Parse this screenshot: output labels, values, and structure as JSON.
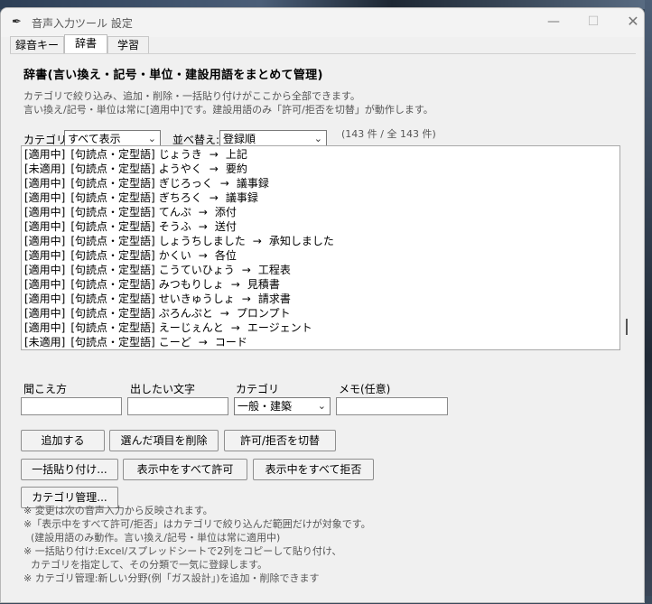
{
  "window": {
    "title": "音声入力ツール 設定",
    "app_icon": "feather-icon",
    "controls": {
      "minimize": "—",
      "maximize": "☐",
      "close": "✕"
    }
  },
  "tabs": [
    {
      "label": "録音キー",
      "selected": false
    },
    {
      "label": "辞書",
      "selected": true
    },
    {
      "label": "学習",
      "selected": false
    }
  ],
  "dictionary": {
    "heading": "辞書(言い換え・記号・単位・建設用語をまとめて管理)",
    "description_1": "カテゴリで絞り込み、追加・削除・一括貼り付けがここから全部できます。",
    "description_2": "言い換え/記号・単位は常に[適用中]です。建設用語のみ「許可/拒否を切替」が動作します。",
    "filter": {
      "category_label": "カテゴリ:",
      "category_value": "すべて表示",
      "sort_label": "並べ替え:",
      "sort_value": "登録順",
      "count": "(143 件 / 全 143 件)"
    },
    "entries": [
      {
        "status": "[適用中]",
        "category": "[句読点・定型語]",
        "reading": "じょうき",
        "output": "上記"
      },
      {
        "status": "[未適用]",
        "category": "[句読点・定型語]",
        "reading": "ようやく",
        "output": "要約"
      },
      {
        "status": "[適用中]",
        "category": "[句読点・定型語]",
        "reading": "ぎじろっく",
        "output": "議事録"
      },
      {
        "status": "[適用中]",
        "category": "[句読点・定型語]",
        "reading": "ぎちろく",
        "output": "議事録"
      },
      {
        "status": "[適用中]",
        "category": "[句読点・定型語]",
        "reading": "てんぷ",
        "output": "添付"
      },
      {
        "status": "[適用中]",
        "category": "[句読点・定型語]",
        "reading": "そうふ",
        "output": "送付"
      },
      {
        "status": "[適用中]",
        "category": "[句読点・定型語]",
        "reading": "しょうちしました",
        "output": "承知しました"
      },
      {
        "status": "[適用中]",
        "category": "[句読点・定型語]",
        "reading": "かくい",
        "output": "各位"
      },
      {
        "status": "[適用中]",
        "category": "[句読点・定型語]",
        "reading": "こうていひょう",
        "output": "工程表"
      },
      {
        "status": "[適用中]",
        "category": "[句読点・定型語]",
        "reading": "みつもりしょ",
        "output": "見積書"
      },
      {
        "status": "[適用中]",
        "category": "[句読点・定型語]",
        "reading": "せいきゅうしょ",
        "output": "請求書"
      },
      {
        "status": "[適用中]",
        "category": "[句読点・定型語]",
        "reading": "ぷろんぷと",
        "output": "プロンプト"
      },
      {
        "status": "[適用中]",
        "category": "[句読点・定型語]",
        "reading": "えーじぇんと",
        "output": "エージェント"
      },
      {
        "status": "[未適用]",
        "category": "[句読点・定型語]",
        "reading": "こーど",
        "output": "コード"
      }
    ],
    "arrow": "→",
    "form": {
      "reading_label": "聞こえ方",
      "output_label": "出したい文字",
      "category_label": "カテゴリ",
      "category_value": "一般・建築",
      "memo_label": "メモ(任意)"
    },
    "buttons": {
      "add": "追加する",
      "delete": "選んだ項目を削除",
      "toggle": "許可/拒否を切替",
      "bulk_paste": "一括貼り付け...",
      "allow_all": "表示中をすべて許可",
      "deny_all": "表示中をすべて拒否",
      "category_manage": "カテゴリ管理..."
    },
    "notes": [
      "※ 変更は次の音声入力から反映されます。",
      "※「表示中をすべて許可/拒否」はカテゴリで絞り込んだ範囲だけが対象です。",
      "(建設用語のみ動作。言い換え/記号・単位は常に適用中)",
      "※ 一括貼り付け:Excel/スプレッドシートで2列をコピーして貼り付け、",
      "カテゴリを指定して、その分類で一気に登録します。",
      "※ カテゴリ管理:新しい分野(例「ガス設計」)を追加・削除できます"
    ]
  }
}
